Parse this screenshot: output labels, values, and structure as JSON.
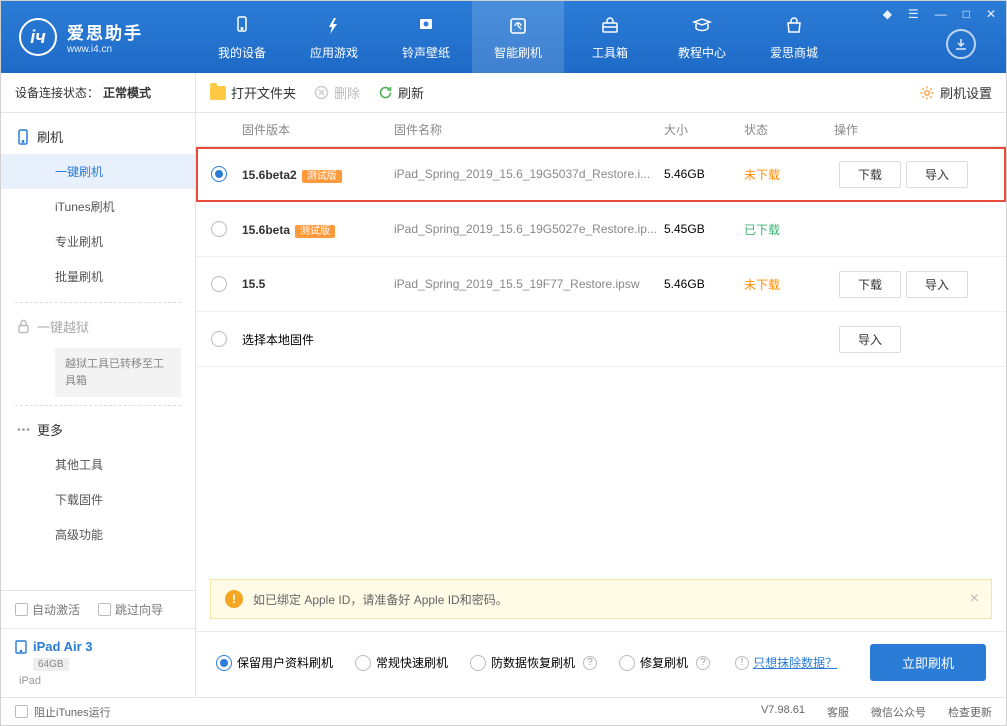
{
  "app": {
    "title": "爱思助手",
    "subtitle": "www.i4.cn"
  },
  "nav": {
    "tabs": [
      {
        "label": "我的设备",
        "icon": "device"
      },
      {
        "label": "应用游戏",
        "icon": "apps"
      },
      {
        "label": "铃声壁纸",
        "icon": "ringtone"
      },
      {
        "label": "智能刷机",
        "icon": "flash"
      },
      {
        "label": "工具箱",
        "icon": "toolbox"
      },
      {
        "label": "教程中心",
        "icon": "tutorial"
      },
      {
        "label": "爱思商城",
        "icon": "shop"
      }
    ]
  },
  "status": {
    "label": "设备连接状态：",
    "value": "正常模式"
  },
  "toolbar": {
    "open_folder": "打开文件夹",
    "delete": "删除",
    "refresh": "刷新",
    "settings": "刷机设置"
  },
  "sidebar": {
    "flash": {
      "header": "刷机",
      "items": [
        "一键刷机",
        "iTunes刷机",
        "专业刷机",
        "批量刷机"
      ]
    },
    "jailbreak": {
      "header": "一键越狱",
      "note": "越狱工具已转移至工具箱"
    },
    "more": {
      "header": "更多",
      "items": [
        "其他工具",
        "下载固件",
        "高级功能"
      ]
    }
  },
  "checks": {
    "auto_activate": "自动激活",
    "skip_guide": "跳过向导"
  },
  "device": {
    "name": "iPad Air 3",
    "capacity": "64GB",
    "type": "iPad"
  },
  "table": {
    "headers": {
      "version": "固件版本",
      "name": "固件名称",
      "size": "大小",
      "status": "状态",
      "actions": "操作"
    },
    "rows": [
      {
        "version": "15.6beta2",
        "beta": "测试版",
        "name": "iPad_Spring_2019_15.6_19G5037d_Restore.i...",
        "size": "5.46GB",
        "status": "未下载",
        "status_class": "pending",
        "selected": true,
        "highlighted": true,
        "show_actions": true
      },
      {
        "version": "15.6beta",
        "beta": "测试版",
        "name": "iPad_Spring_2019_15.6_19G5027e_Restore.ip...",
        "size": "5.45GB",
        "status": "已下载",
        "status_class": "done",
        "selected": false,
        "highlighted": false,
        "show_actions": false
      },
      {
        "version": "15.5",
        "beta": "",
        "name": "iPad_Spring_2019_15.5_19F77_Restore.ipsw",
        "size": "5.46GB",
        "status": "未下载",
        "status_class": "pending",
        "selected": false,
        "highlighted": false,
        "show_actions": true
      }
    ],
    "local_row": "选择本地固件",
    "btn_download": "下载",
    "btn_import": "导入"
  },
  "notice": "如已绑定 Apple ID，请准备好 Apple ID和密码。",
  "flash_options": {
    "items": [
      "保留用户资料刷机",
      "常规快速刷机",
      "防数据恢复刷机",
      "修复刷机"
    ],
    "erase_link": "只想抹除数据？",
    "btn": "立即刷机"
  },
  "footer": {
    "block_itunes": "阻止iTunes运行",
    "version": "V7.98.61",
    "items": [
      "客服",
      "微信公众号",
      "检查更新"
    ]
  }
}
